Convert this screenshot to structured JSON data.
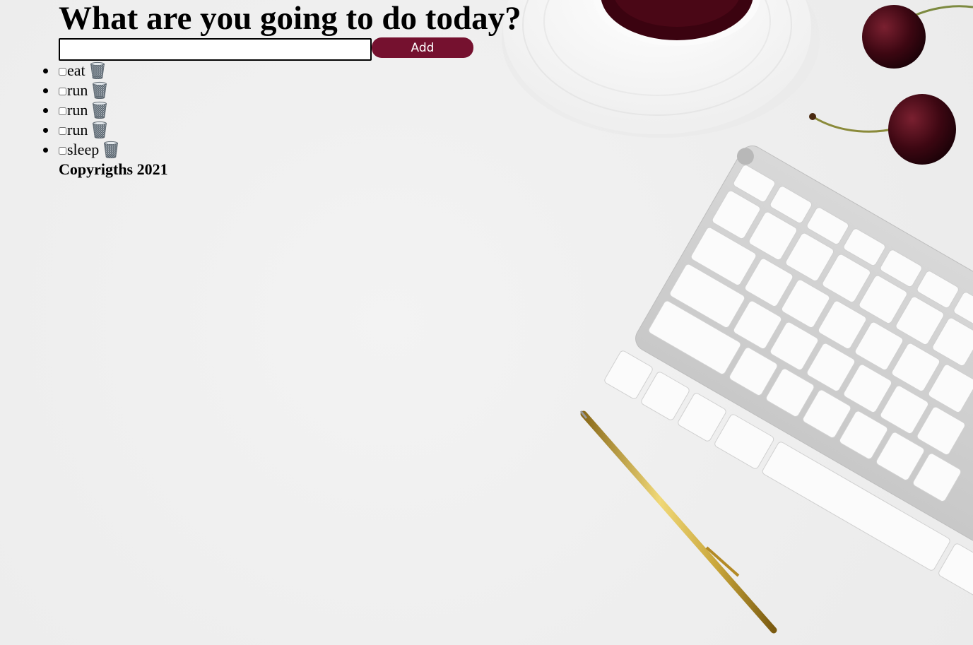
{
  "header": {
    "title": "What are you going to do today?"
  },
  "form": {
    "input_value": "",
    "add_label": "Add"
  },
  "todos": [
    {
      "label": "eat",
      "checked": false,
      "delete_icon": "trash-icon"
    },
    {
      "label": "run",
      "checked": false,
      "delete_icon": "trash-icon"
    },
    {
      "label": "run",
      "checked": false,
      "delete_icon": "trash-icon"
    },
    {
      "label": "run",
      "checked": false,
      "delete_icon": "trash-icon"
    },
    {
      "label": "sleep",
      "checked": false,
      "delete_icon": "trash-icon"
    }
  ],
  "footer": {
    "text": "Copyrigths 2021"
  },
  "colors": {
    "accent": "#75112f",
    "background": "#eeeeee",
    "text": "#000000"
  }
}
